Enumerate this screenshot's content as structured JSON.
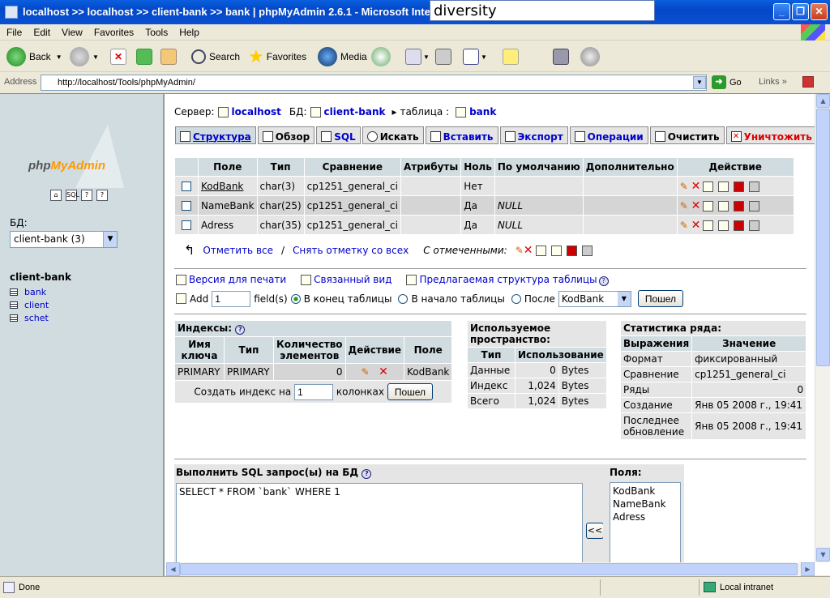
{
  "window": {
    "title": "localhost >> localhost >> client-bank >> bank | phpMyAdmin 2.6.1 - Microsoft Internet Explorer",
    "tooltip": "diversity"
  },
  "menu": [
    "File",
    "Edit",
    "View",
    "Favorites",
    "Tools",
    "Help"
  ],
  "toolbar": {
    "back": "Back",
    "search": "Search",
    "favorites": "Favorites",
    "media": "Media"
  },
  "address": {
    "label": "Address",
    "url": "http://localhost/Tools/phpMyAdmin/",
    "go": "Go",
    "links": "Links"
  },
  "left": {
    "logo_php": "php",
    "logo_myadmin": "MyAdmin",
    "db_label": "БД:",
    "db_selected": "client-bank (3)",
    "db_title": "client-bank",
    "tables": [
      "bank",
      "client",
      "schet"
    ]
  },
  "breadcrumb": {
    "server_label": "Сервер:",
    "server": "localhost",
    "db_label": "БД:",
    "db": "client-bank",
    "table_label": "таблица :",
    "table": "bank"
  },
  "tabs": [
    "Структура",
    "Обзор",
    "SQL",
    "Искать",
    "Вставить",
    "Экспорт",
    "Операции",
    "Очистить",
    "Уничтожить"
  ],
  "structure": {
    "headers": [
      "Поле",
      "Тип",
      "Сравнение",
      "Атрибуты",
      "Ноль",
      "По умолчанию",
      "Дополнительно",
      "Действие"
    ],
    "rows": [
      {
        "field": "KodBank",
        "type": "char(3)",
        "collation": "cp1251_general_ci",
        "attr": "",
        "null": "Нет",
        "default": "",
        "extra": ""
      },
      {
        "field": "NameBank",
        "type": "char(25)",
        "collation": "cp1251_general_ci",
        "attr": "",
        "null": "Да",
        "default": "NULL",
        "extra": ""
      },
      {
        "field": "Adress",
        "type": "char(35)",
        "collation": "cp1251_general_ci",
        "attr": "",
        "null": "Да",
        "default": "NULL",
        "extra": ""
      }
    ],
    "check_all": "Отметить все",
    "sep": "/",
    "uncheck_all": "Снять отметку со всех",
    "with_selected": "С отмеченными:"
  },
  "links": {
    "print": "Версия для печати",
    "related": "Связанный вид",
    "propose": "Предлагаемая структура таблицы"
  },
  "addfield": {
    "add": "Add",
    "count": "1",
    "fields": "field(s)",
    "end": "В конец таблицы",
    "begin": "В начало таблицы",
    "after": "После",
    "after_field": "KodBank",
    "go": "Пошел"
  },
  "indexes": {
    "title": "Индексы:",
    "headers": [
      "Имя ключа",
      "Тип",
      "Количество элементов",
      "Действие",
      "Поле"
    ],
    "row": {
      "name": "PRIMARY",
      "type": "PRIMARY",
      "count": "0",
      "field": "KodBank"
    },
    "create_label": "Создать индекс на",
    "create_count": "1",
    "create_suffix": "колонках",
    "go": "Пошел"
  },
  "space": {
    "title": "Используемое пространство:",
    "headers": [
      "Тип",
      "Использование"
    ],
    "rows": [
      {
        "type": "Данные",
        "value": "0",
        "unit": "Bytes"
      },
      {
        "type": "Индекс",
        "value": "1,024",
        "unit": "Bytes"
      },
      {
        "type": "Всего",
        "value": "1,024",
        "unit": "Bytes"
      }
    ]
  },
  "stats": {
    "title": "Статистика ряда:",
    "headers": [
      "Выражения",
      "Значение"
    ],
    "rows": [
      {
        "k": "Формат",
        "v": "фиксированный"
      },
      {
        "k": "Сравнение",
        "v": "cp1251_general_ci"
      },
      {
        "k": "Ряды",
        "v": "0"
      },
      {
        "k": "Создание",
        "v": "Янв 05 2008 г., 19:41"
      },
      {
        "k": "Последнее обновление",
        "v": "Янв 05 2008 г., 19:41"
      }
    ]
  },
  "sql": {
    "title": "Выполнить SQL запрос(ы) на БД",
    "query": "SELECT * FROM `bank` WHERE 1",
    "insert_btn": "<<",
    "fields_title": "Поля:",
    "fields": [
      "KodBank",
      "NameBank",
      "Adress"
    ]
  },
  "status": {
    "text": "Done",
    "zone": "Local intranet"
  }
}
